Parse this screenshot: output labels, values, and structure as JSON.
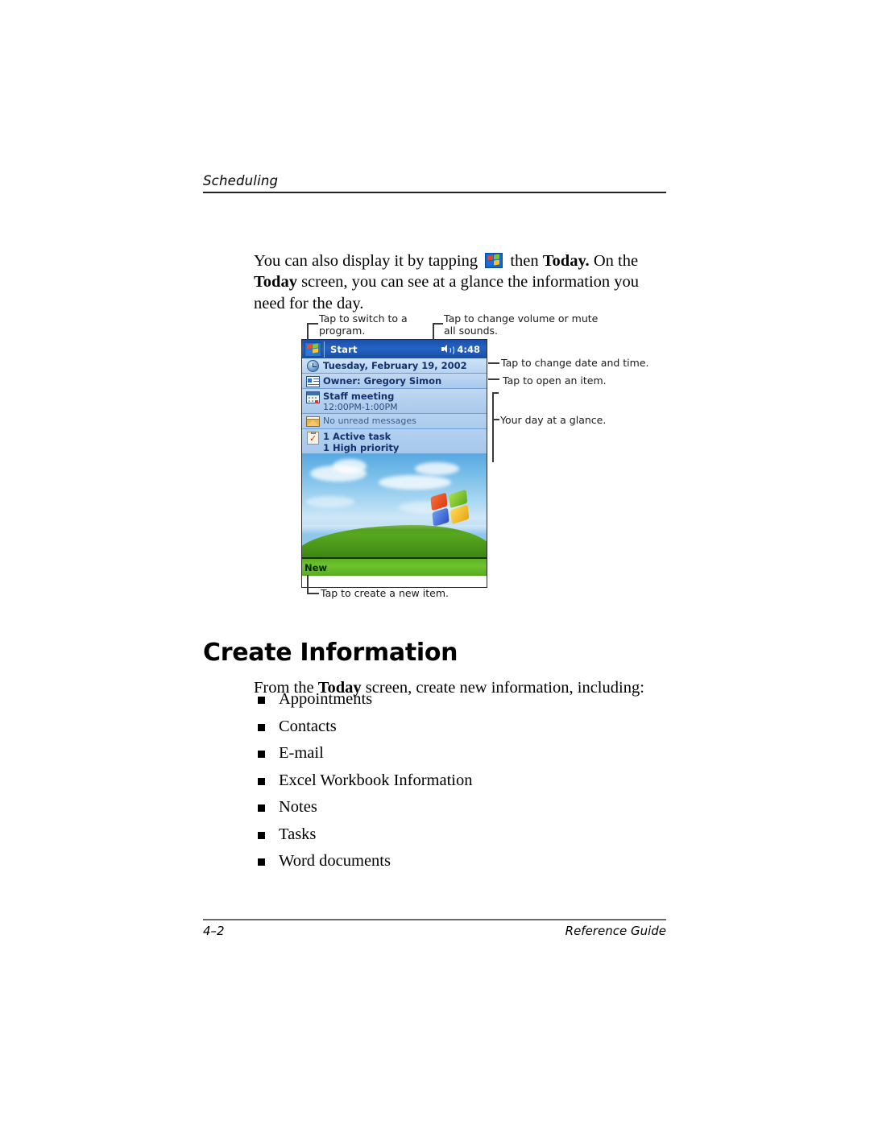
{
  "page": {
    "running_head": "Scheduling",
    "footer_page_number": "4–2",
    "footer_guide": "Reference Guide"
  },
  "intro": {
    "part1": "You can also display it by tapping ",
    "icon": "windows-start-flag-icon",
    "part2": " then ",
    "bold1": "Today.",
    "part3": " On the ",
    "bold2": "Today",
    "part4": " screen, you can see at a glance the information you need for the day."
  },
  "figure": {
    "titlebar": {
      "start_label": "Start",
      "start_icon": "windows-start-flag-icon",
      "volume_icon": "speaker-volume-icon",
      "clock": "4:48"
    },
    "rows": [
      {
        "icon": "clock-icon",
        "primary": "Tuesday, February 19, 2002",
        "secondary": ""
      },
      {
        "icon": "owner-card-icon",
        "primary": "Owner: Gregory Simon",
        "secondary": ""
      },
      {
        "icon": "calendar-icon",
        "primary": "Staff meeting",
        "secondary": "12:00PM-1:00PM"
      },
      {
        "icon": "mail-icon",
        "primary": "",
        "secondary": "No unread messages"
      },
      {
        "icon": "task-clipboard-icon",
        "primary": "1 Active task",
        "secondary": "1 High priority"
      }
    ],
    "wallpaper_logo": "windows-xp-logo",
    "newbar_label": "New",
    "callouts": {
      "switch_program": "Tap to switch to a\nprogram.",
      "volume": "Tap to change volume or mute\nall sounds.",
      "date_time": "Tap to change date and time.",
      "open_item": "Tap to open an item.",
      "day_glance": "Your day at a glance.",
      "new_item": "Tap to create a new item."
    }
  },
  "section": {
    "heading": "Create Information",
    "intro_part1": "From the ",
    "intro_bold": "Today",
    "intro_part2": " screen, create new information, including:",
    "items": [
      "Appointments",
      "Contacts",
      "E-mail",
      "Excel Workbook Information",
      "Notes",
      "Tasks",
      "Word documents"
    ]
  }
}
